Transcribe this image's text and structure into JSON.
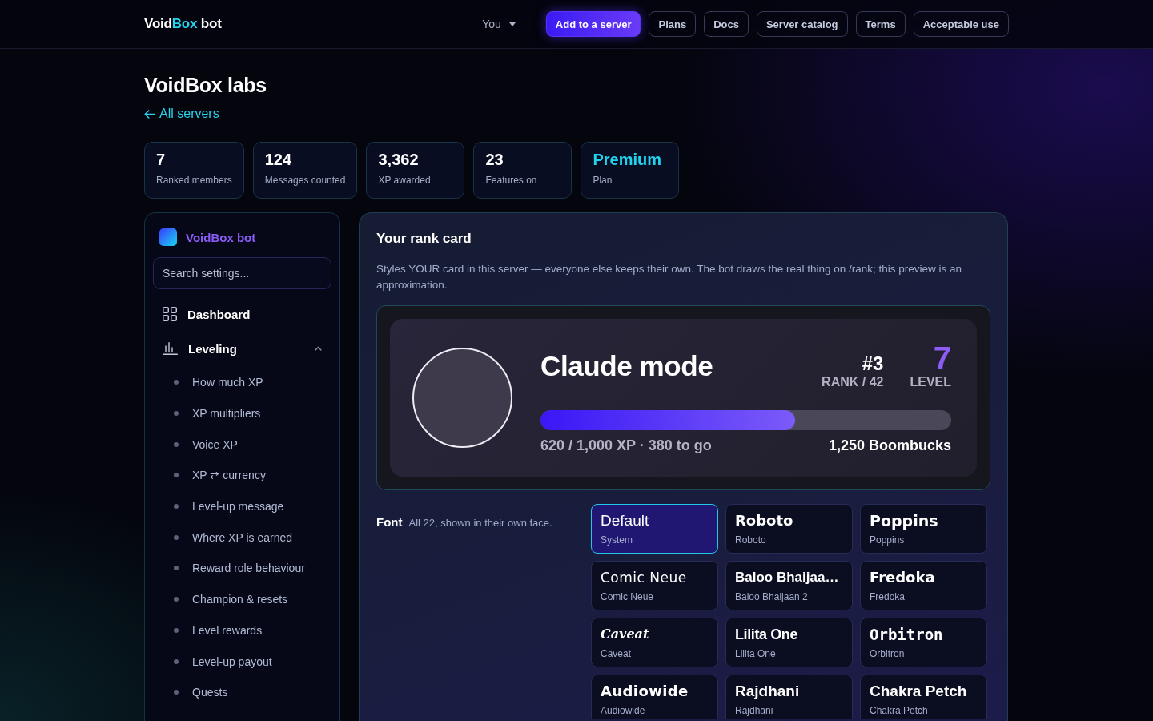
{
  "topbar": {
    "brand": [
      {
        "text": "Void",
        "accent": false
      },
      {
        "text": "Box",
        "accent": true
      },
      {
        "text": " bot",
        "accent": false
      }
    ],
    "user_menu": {
      "label": "You"
    },
    "buttons": [
      {
        "label": "Add to a server",
        "kind": "primary"
      },
      {
        "label": "Plans",
        "kind": "outline"
      },
      {
        "label": "Docs",
        "kind": "outline"
      },
      {
        "label": "Server catalog",
        "kind": "outline"
      },
      {
        "label": "Terms",
        "kind": "outline"
      },
      {
        "label": "Acceptable use",
        "kind": "outline"
      }
    ]
  },
  "page": {
    "title": "VoidBox labs",
    "back_link": "All servers"
  },
  "stats": [
    {
      "value": "7",
      "label": "Ranked members",
      "accent": false
    },
    {
      "value": "124",
      "label": "Messages counted",
      "accent": false
    },
    {
      "value": "3,362",
      "label": "XP awarded",
      "accent": false
    },
    {
      "value": "23",
      "label": "Features on",
      "accent": false
    },
    {
      "value": "Premium",
      "label": "Plan",
      "accent": true
    }
  ],
  "sidebar": {
    "title": "VoidBox bot",
    "search": {
      "placeholder": "Search settings..."
    },
    "items": [
      {
        "label": "Dashboard",
        "kind": "link"
      },
      {
        "label": "Leveling",
        "kind": "group",
        "expanded": true,
        "children": [
          {
            "label": "How much XP"
          },
          {
            "label": "XP multipliers"
          },
          {
            "label": "Voice XP"
          },
          {
            "label": "XP ⇄ currency"
          },
          {
            "label": "Level-up message"
          },
          {
            "label": "Where XP is earned"
          },
          {
            "label": "Reward role behaviour"
          },
          {
            "label": "Champion & resets"
          },
          {
            "label": "Level rewards"
          },
          {
            "label": "Level-up payout"
          },
          {
            "label": "Quests"
          }
        ]
      }
    ]
  },
  "rank_section": {
    "title": "Your rank card",
    "description": "Styles YOUR card in this server — everyone else keeps their own. The bot draws the real thing on /rank; this preview is an approximation.",
    "preview": {
      "name": "Claude mode",
      "rank": "#3",
      "rank_label": "RANK / 42",
      "level_number": "7",
      "level_label": "LEVEL",
      "progress": {
        "level": 0.62
      },
      "xp_text": "620 / 1,000 XP · 380 to go",
      "currency": "1,250 Boombucks"
    }
  },
  "font_picker": {
    "label": "Font",
    "hint": "All 22, shown in their own face.",
    "options": [
      {
        "name": "Default",
        "family": "System",
        "selected": true
      },
      {
        "name": "Roboto",
        "family": "Roboto",
        "selected": false
      },
      {
        "name": "Poppins",
        "family": "Poppins",
        "selected": false
      },
      {
        "name": "Comic Neue",
        "family": "Comic Neue",
        "selected": false
      },
      {
        "name": "Baloo Bhaijaa…",
        "family": "Baloo Bhaijaan 2",
        "selected": false
      },
      {
        "name": "Fredoka",
        "family": "Fredoka",
        "selected": false
      },
      {
        "name": "Caveat",
        "family": "Caveat",
        "selected": false
      },
      {
        "name": "Lilita One",
        "family": "Lilita One",
        "selected": false
      },
      {
        "name": "Orbitron",
        "family": "Orbitron",
        "selected": false
      },
      {
        "name": "Audiowide",
        "family": "Audiowide",
        "selected": false
      },
      {
        "name": "Rajdhani",
        "family": "Rajdhani",
        "selected": false
      },
      {
        "name": "Chakra Petch",
        "family": "Chakra Petch",
        "selected": false
      }
    ]
  }
}
